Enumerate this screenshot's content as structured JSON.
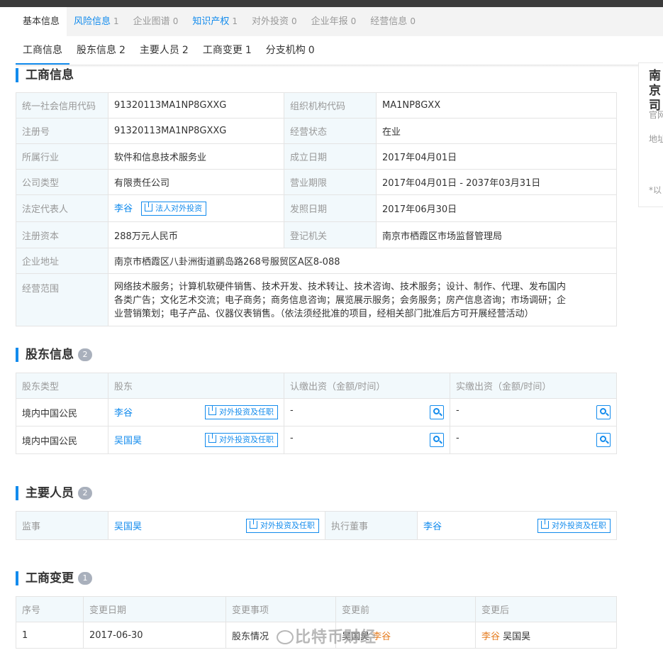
{
  "tabs_main": [
    {
      "label": "基本信息",
      "count": ""
    },
    {
      "label": "风险信息",
      "count": "1"
    },
    {
      "label": "企业图谱",
      "count": "0"
    },
    {
      "label": "知识产权",
      "count": "1"
    },
    {
      "label": "对外投资",
      "count": "0"
    },
    {
      "label": "企业年报",
      "count": "0"
    },
    {
      "label": "经营信息",
      "count": "0"
    }
  ],
  "tabs_sub": [
    {
      "label": "工商信息",
      "count": ""
    },
    {
      "label": "股东信息",
      "count": "2"
    },
    {
      "label": "主要人员",
      "count": "2"
    },
    {
      "label": "工商变更",
      "count": "1"
    },
    {
      "label": "分支机构",
      "count": "0"
    }
  ],
  "side": {
    "title": "南京司",
    "line1": "官网",
    "line2": "地址",
    "note": "*以"
  },
  "business": {
    "title": "工商信息",
    "rows": [
      {
        "l1": "统一社会信用代码",
        "v1": "91320113MA1NP8GXXG",
        "l2": "组织机构代码",
        "v2": "MA1NP8GXX"
      },
      {
        "l1": "注册号",
        "v1": "91320113MA1NP8GXXG",
        "l2": "经营状态",
        "v2": "在业"
      },
      {
        "l1": "所属行业",
        "v1": "软件和信息技术服务业",
        "l2": "成立日期",
        "v2": "2017年04月01日"
      },
      {
        "l1": "公司类型",
        "v1": "有限责任公司",
        "l2": "营业期限",
        "v2": "2017年04月01日 - 2037年03月31日"
      },
      {
        "l1": "法定代表人",
        "v1": "李谷",
        "l2": "发照日期",
        "v2": "2017年06月30日"
      },
      {
        "l1": "注册资本",
        "v1": "288万元人民币",
        "l2": "登记机关",
        "v2": "南京市栖霞区市场监督管理局"
      }
    ],
    "legal_btn": "法人对外投资",
    "address_label": "企业地址",
    "address": "南京市栖霞区八卦洲街道鹂岛路268号服贸区A区8-088",
    "scope_label": "经营范围",
    "scope_lines": [
      "网络技术服务；计算机软硬件销售、技术开发、技术转让、技术咨询、技术服务；设计、制作、代理、发布国内",
      "各类广告；文化艺术交流；电子商务；商务信息咨询；展览展示服务；会务服务；房产信息咨询；市场调研；企",
      "业营销策划；电子产品、仪器仪表销售。（依法须经批准的项目，经相关部门批准后方可开展经营活动）"
    ]
  },
  "shareholders": {
    "title": "股东信息",
    "count": "2",
    "headers": [
      "股东类型",
      "股东",
      "认缴出资（金额/时间）",
      "实缴出资（金额/时间）"
    ],
    "rows": [
      {
        "type": "境内中国公民",
        "name": "李谷",
        "sub": "-",
        "paid": "-"
      },
      {
        "type": "境内中国公民",
        "name": "吴国昊",
        "sub": "-",
        "paid": "-"
      }
    ],
    "btn": "对外投资及任职"
  },
  "staff": {
    "title": "主要人员",
    "count": "2",
    "role1": "监事",
    "name1": "吴国昊",
    "role2": "执行董事",
    "name2": "李谷",
    "btn": "对外投资及任职"
  },
  "changes": {
    "title": "工商变更",
    "count": "1",
    "headers": [
      "序号",
      "变更日期",
      "变更事项",
      "变更前",
      "变更后"
    ],
    "rows": [
      {
        "no": "1",
        "date": "2017-06-30",
        "item": "股东情况",
        "before_a": "吴国昊",
        "before_b": "李谷",
        "after_a": "李谷",
        "after_b": "吴国昊"
      }
    ]
  },
  "watermark": "比特币财经"
}
